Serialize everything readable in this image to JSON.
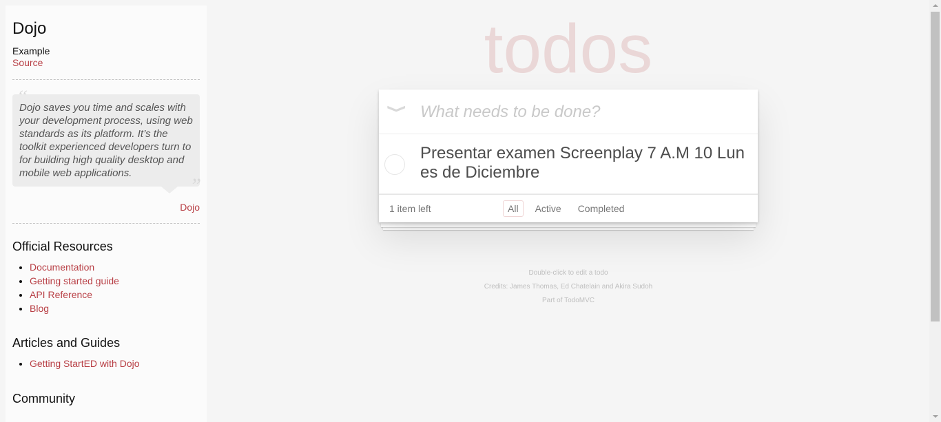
{
  "sidebar": {
    "framework": "Dojo",
    "example_label": "Example",
    "source_label": "Source",
    "quote": "Dojo saves you time and scales with your development process, using web standards as its platform. It’s the toolkit experienced developers turn to for building high quality desktop and mobile web applications.",
    "quote_open": "“",
    "quote_close": "”",
    "quote_author": "Dojo",
    "official_title": "Official Resources",
    "official_links": [
      "Documentation",
      "Getting started guide",
      "API Reference",
      "Blog"
    ],
    "articles_title": "Articles and Guides",
    "articles_links": [
      "Getting StartED with Dojo"
    ],
    "community_title": "Community"
  },
  "app": {
    "title": "todos",
    "toggle_all_icon": "❯",
    "new_todo_placeholder": "What needs to be done?",
    "todos": [
      {
        "text": "Presentar examen Screenplay 7 A.M 10 Lunes de Diciembre",
        "completed": false
      }
    ],
    "count_text": "1 item left",
    "filters": [
      "All",
      "Active",
      "Completed"
    ],
    "selected_filter": "All"
  },
  "info": {
    "hint": "Double-click to edit a todo",
    "credits": "Credits: James Thomas, Ed Chatelain and Akira Sudoh",
    "part_of": "Part of TodoMVC"
  },
  "colors": {
    "accent": "#b83f45",
    "background": "#f5f5f5"
  }
}
